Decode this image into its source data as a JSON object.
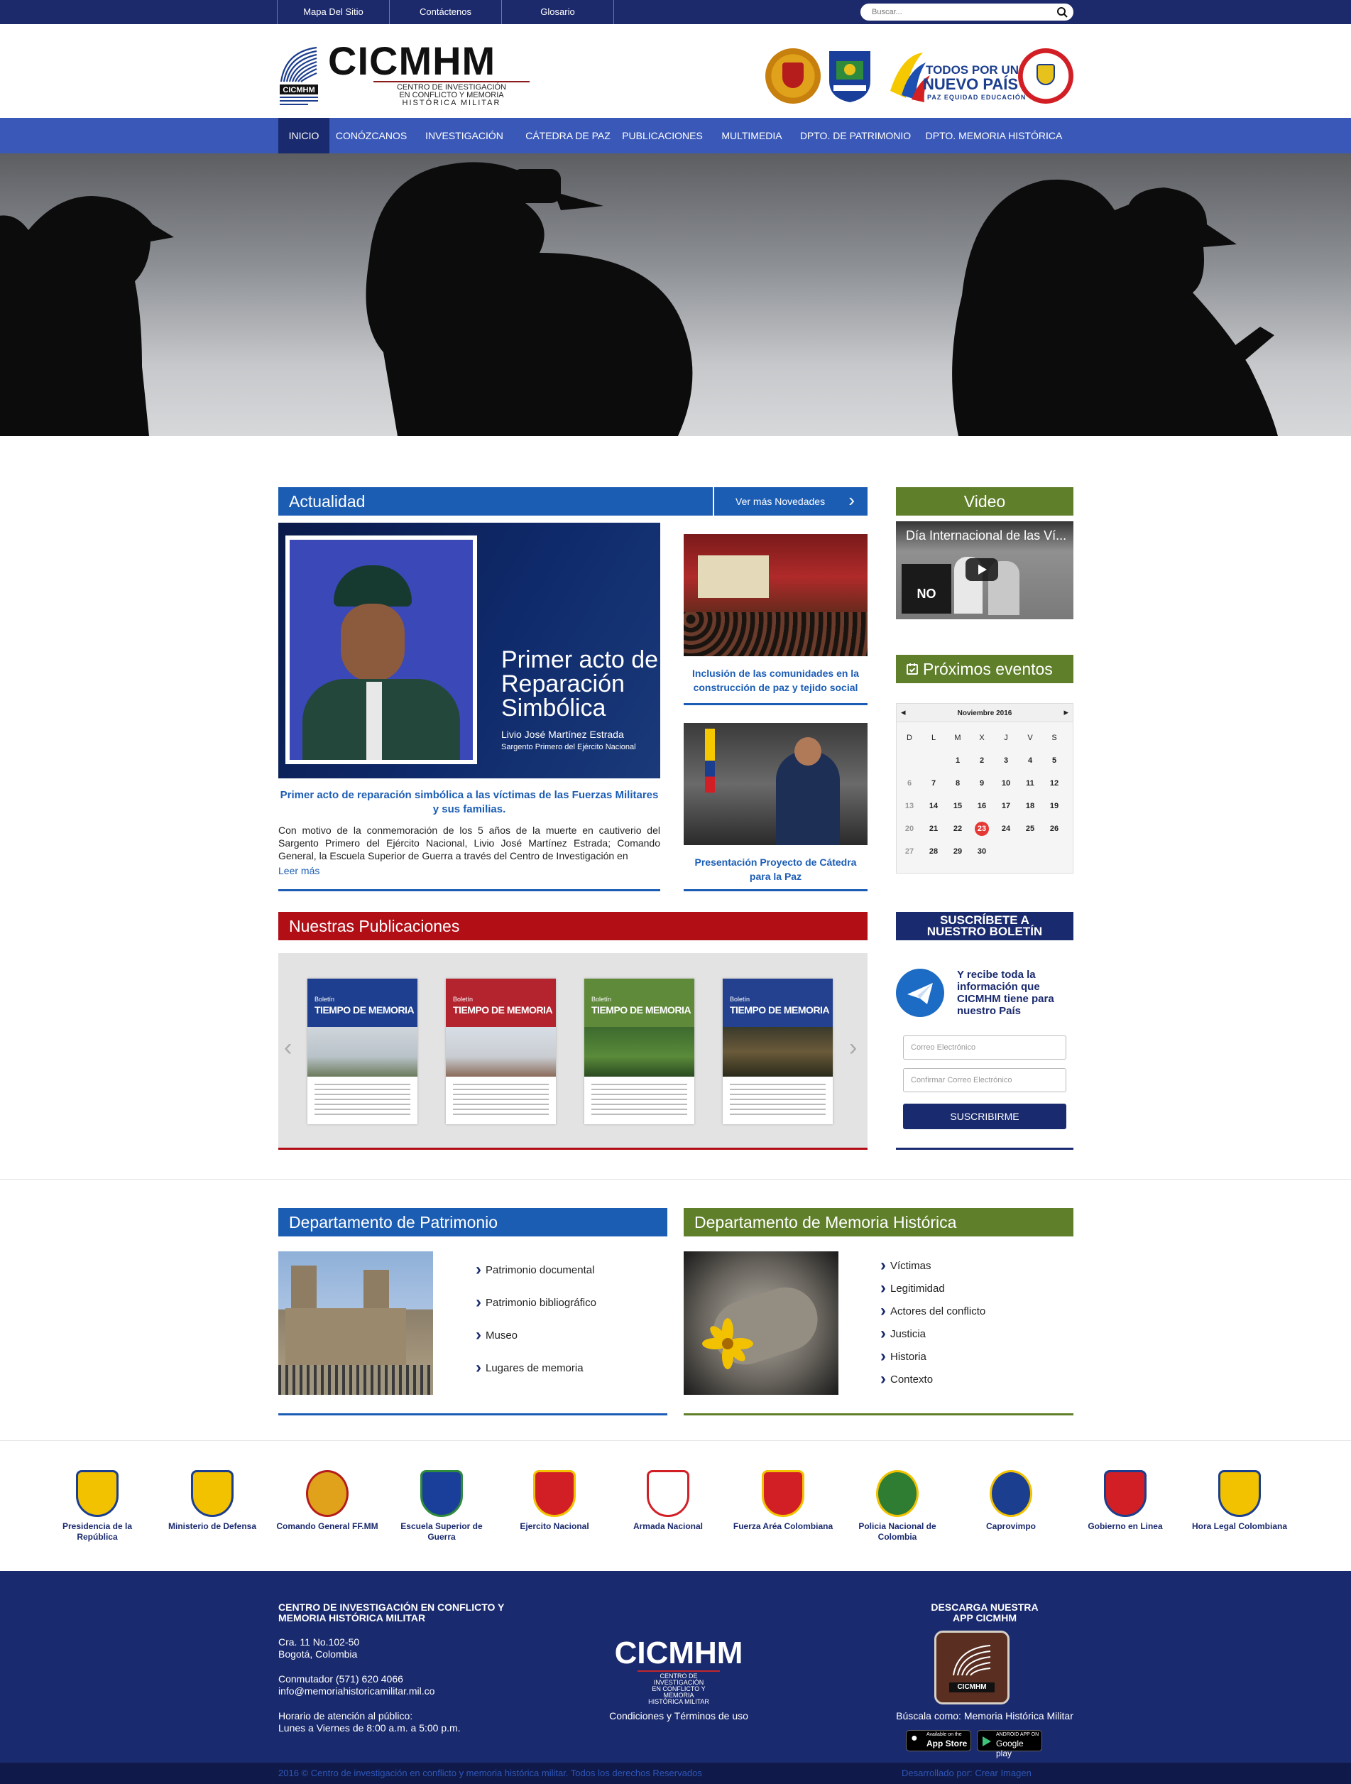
{
  "topbar": {
    "links": [
      "Mapa Del Sitio",
      "Contáctenos",
      "Glosario"
    ],
    "search_placeholder": "Buscar..."
  },
  "header": {
    "logo_text": "CICMHM",
    "logo_subtitle_1": "CENTRO DE INVESTIGACIÓN",
    "logo_subtitle_2": "EN CONFLICTO Y MEMORIA",
    "logo_subtitle_3": "HISTÓRICA MILITAR",
    "gov_slogan_1": "TODOS POR UN",
    "gov_slogan_2": "NUEVO PAÍS",
    "gov_slogan_3": "PAZ EQUIDAD EDUCACIÓN"
  },
  "nav": {
    "items": [
      "INICIO",
      "CONÓZCANOS",
      "INVESTIGACIÓN",
      "CÁTEDRA DE PAZ",
      "PUBLICACIONES",
      "MULTIMEDIA",
      "DPTO. DE PATRIMONIO",
      "DPTO. MEMORIA HISTÓRICA"
    ],
    "active": "INICIO"
  },
  "actualidad": {
    "title": "Actualidad",
    "more_label": "Ver más Novedades",
    "featured": {
      "image_heading_1": "Primer acto de",
      "image_heading_2": "Reparación",
      "image_heading_3": "Simbólica",
      "image_name": "Livio José Martínez Estrada",
      "image_rank": "Sargento Primero del Ejército Nacional",
      "title": "Primer acto de reparación simbólica a las víctimas de las Fuerzas Militares y sus familias.",
      "excerpt": "Con motivo de la conmemoración de los 5 años de la muerte en cautiverio del Sargento Primero del Ejército Nacional, Livio José Martínez Estrada; Comando General, la Escuela Superior de Guerra a través del Centro de Investigación en",
      "read_more": "Leer más"
    },
    "side": [
      {
        "title": "Inclusión de las comunidades en la construcción de paz y tejido social"
      },
      {
        "title": "Presentación Proyecto de Cátedra para la Paz"
      }
    ]
  },
  "video": {
    "title": "Video",
    "caption": "Día Internacional de las Ví...",
    "sign_text": "NO MAS"
  },
  "eventos": {
    "title": "Próximos eventos",
    "month": "Noviembre 2016",
    "weekdays": [
      "D",
      "L",
      "M",
      "X",
      "J",
      "V",
      "S"
    ],
    "weeks": [
      [
        "",
        "",
        "1",
        "2",
        "3",
        "4",
        "5"
      ],
      [
        "6",
        "7",
        "8",
        "9",
        "10",
        "11",
        "12"
      ],
      [
        "13",
        "14",
        "15",
        "16",
        "17",
        "18",
        "19"
      ],
      [
        "20",
        "21",
        "22",
        "23",
        "24",
        "25",
        "26"
      ],
      [
        "27",
        "28",
        "29",
        "30",
        "",
        "",
        ""
      ]
    ],
    "today": "23"
  },
  "publicaciones": {
    "title": "Nuestras Publicaciones",
    "covers": [
      {
        "kicker": "Boletín",
        "title": "TIEMPO DE MEMORIA",
        "color": "#1e3f8f"
      },
      {
        "kicker": "Boletín",
        "title": "TIEMPO DE MEMORIA",
        "color": "#b3242f"
      },
      {
        "kicker": "Boletín",
        "title": "TIEMPO DE MEMORIA",
        "color": "#5f8a3a"
      },
      {
        "kicker": "Boletín",
        "title": "TIEMPO DE MEMORIA",
        "color": "#23418f"
      }
    ]
  },
  "boletin": {
    "title_1": "SUSCRÍBETE A",
    "title_2": "NUESTRO BOLETÍN",
    "text": "Y recibe toda la información que CICMHM tiene para nuestro País",
    "email_placeholder": "Correo Electrónico",
    "confirm_placeholder": "Confirmar Correo Electrónico",
    "button": "SUSCRIBIRME"
  },
  "patrimonio": {
    "title": "Departamento de Patrimonio",
    "links": [
      "Patrimonio documental",
      "Patrimonio bibliográfico",
      "Museo",
      "Lugares de memoria"
    ]
  },
  "memoria": {
    "title": "Departamento de Memoria Histórica",
    "links": [
      "Víctimas",
      "Legitimidad",
      "Actores del conflicto",
      "Justicia",
      "Historia",
      "Contexto"
    ]
  },
  "partners": [
    "Presidencia de la República",
    "Ministerio de Defensa",
    "Comando General FF.MM",
    "Escuela Superior de Guerra",
    "Ejercito Nacional",
    "Armada Nacional",
    "Fuerza Aréa Colombiana",
    "Policia Nacional de Colombia",
    "Caprovimpo",
    "Gobierno en Linea",
    "Hora Legal Colombiana"
  ],
  "footer": {
    "org_1": "CENTRO DE INVESTIGACIÓN EN CONFLICTO Y",
    "org_2": "MEMORIA HISTÓRICA MILITAR",
    "address_1": "Cra. 11 No.102-50",
    "address_2": "Bogotá, Colombia",
    "phone": "Conmutador (571) 620 4066",
    "email": "info@memoriahistoricamilitar.mil.co",
    "hours_1": "Horario de atención al público:",
    "hours_2": "Lunes a Viernes de 8:00 a.m. a 5:00 p.m.",
    "logo": "CICMHM",
    "logo_sub_1": "CENTRO DE INVESTIGACIÓN",
    "logo_sub_2": "EN CONFLICTO Y MEMORIA",
    "logo_sub_3": "HISTÓRICA MILITAR",
    "terms": "Condiciones y Términos de uso",
    "app_title_1": "DESCARGA NUESTRA",
    "app_title_2": "APP CICMHM",
    "app_icon_label": "CICMHM",
    "app_search": "Búscala como: Memoria Histórica Militar",
    "appstore_small": "Available on the",
    "appstore": "App Store",
    "googleplay_small": "ANDROID APP ON",
    "googleplay": "Google play",
    "copyright": "2016 © Centro de investigación en conflicto y memoria histórica militar. Todos los derechos Reservados",
    "developer": "Desarrollado por: Crear Imagen"
  }
}
